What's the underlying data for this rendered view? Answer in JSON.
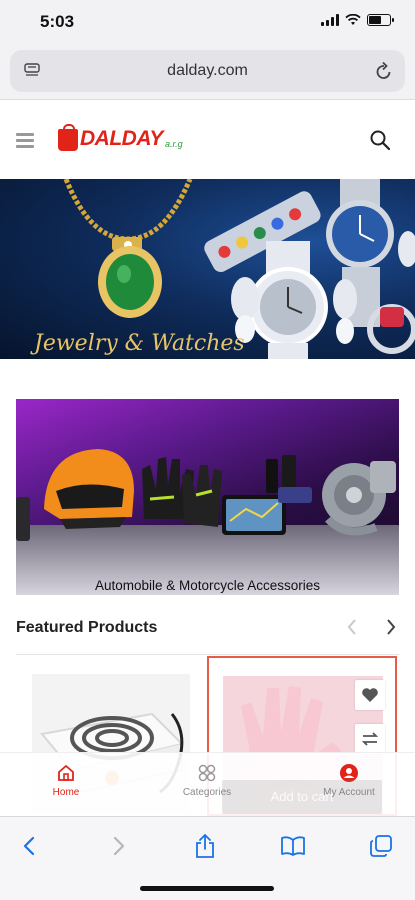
{
  "status_bar": {
    "time": "5:03"
  },
  "browser": {
    "url": "dalday.com"
  },
  "header": {
    "logo_text": "DALDAY",
    "logo_sub": "a.r.g"
  },
  "banners": {
    "jewelry_caption": "Jewelry & Watches",
    "moto_caption": "Automobile & Motorcycle Accessories"
  },
  "featured": {
    "title": "Featured Products",
    "add_to_cart_label": "Add to cart"
  },
  "app_nav": {
    "items": [
      {
        "label": "Home",
        "icon": "home-icon",
        "active": true
      },
      {
        "label": "Categories",
        "icon": "categories-icon",
        "active": false
      },
      {
        "label": "My Account",
        "icon": "account-icon",
        "active": false
      }
    ]
  },
  "colors": {
    "brand": "#e2231a",
    "accent_green": "#2e9b3c",
    "ios_blue": "#1a73e8",
    "card_highlight": "#e85a4a"
  }
}
